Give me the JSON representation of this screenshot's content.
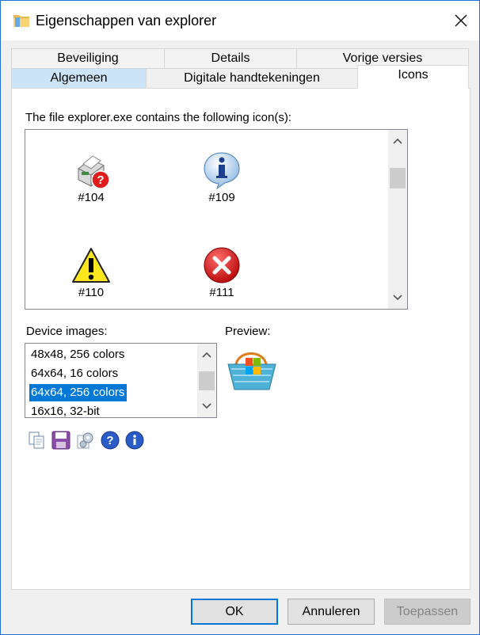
{
  "window": {
    "title": "Eigenschappen van explorer"
  },
  "tabs": {
    "row1": [
      "Beveiliging",
      "Details",
      "Vorige versies"
    ],
    "row2": [
      "Algemeen",
      "Digitale handtekeningen",
      "Icons"
    ]
  },
  "icons_tab": {
    "heading": "The file explorer.exe contains the following icon(s):",
    "icons": [
      {
        "label": "#104",
        "icon": "printer-error-icon"
      },
      {
        "label": "#109",
        "icon": "info-bubble-icon"
      },
      {
        "label": "#110",
        "icon": "warning-icon"
      },
      {
        "label": "#111",
        "icon": "error-icon"
      }
    ],
    "device_images_label": "Device images:",
    "device_images": [
      "48x48, 256 colors",
      "64x64, 16 colors",
      "64x64, 256 colors",
      "16x16, 32-bit"
    ],
    "selected_device_image": "64x64, 256 colors",
    "preview_label": "Preview:",
    "preview_icon": "basket-icon",
    "toolbar_icons": [
      "copy-icon",
      "save-icon",
      "settings-icon",
      "help-icon",
      "info-icon"
    ]
  },
  "buttons": {
    "ok": "OK",
    "cancel": "Annuleren",
    "apply": "Toepassen"
  },
  "colors": {
    "accent": "#0078d7",
    "selected_tab": "#cce4f7",
    "window_border": "#1f6fd6"
  }
}
